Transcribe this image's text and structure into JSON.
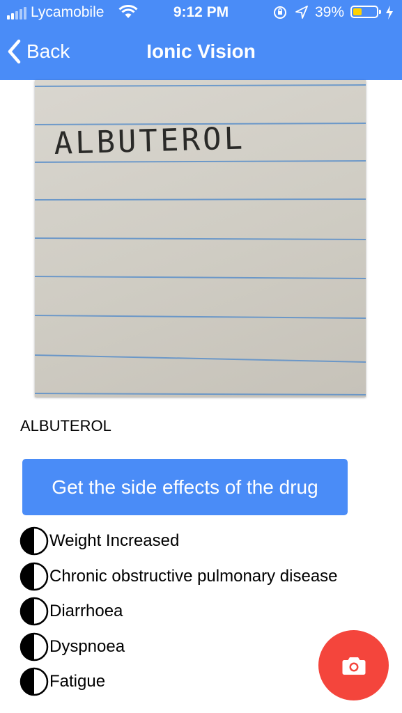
{
  "status_bar": {
    "carrier": "Lycamobile",
    "time": "9:12 PM",
    "battery_percent": "39%",
    "battery_level": 0.39,
    "battery_fill_color": "#ffd200",
    "icons": [
      "signal-icon",
      "wifi-icon",
      "orientation-lock-icon",
      "location-arrow-icon",
      "battery-icon",
      "charging-bolt-icon"
    ]
  },
  "nav": {
    "back_label": "Back",
    "title": "Ionic Vision"
  },
  "photo": {
    "handwritten_text": "ALBUTEROL"
  },
  "result": {
    "drug_name": "ALBUTEROL"
  },
  "action_button": {
    "label": "Get the side effects of the drug"
  },
  "side_effects": [
    "Weight Increased",
    "Chronic obstructive pulmonary disease",
    "Diarrhoea",
    "Dyspnoea",
    "Fatigue"
  ],
  "fab": {
    "icon": "camera-icon"
  },
  "colors": {
    "primary": "#4a8cf7",
    "fab": "#f4453c",
    "text": "#000000"
  }
}
